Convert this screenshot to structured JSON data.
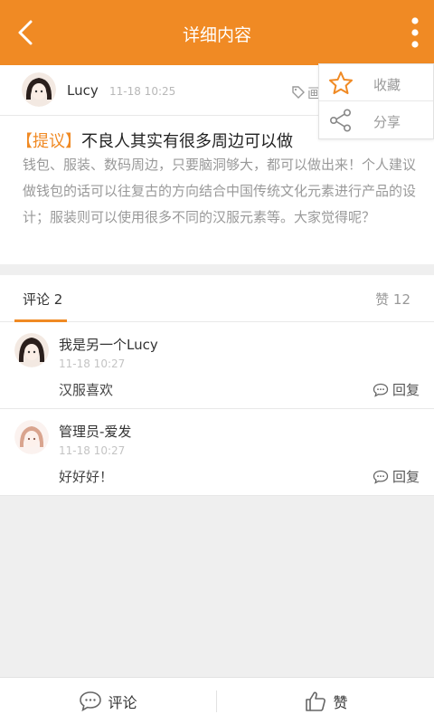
{
  "header": {
    "title": "详细内容",
    "back_icon": "back-arrow-icon",
    "more_icon": "more-vertical-icon",
    "bg_color": "#f08a24"
  },
  "author": {
    "name": "Lucy",
    "time": "11-18 10:25",
    "tag": "画",
    "tag_icon": "tag-icon"
  },
  "post": {
    "tag_label": "【提议】",
    "title": "不良人其实有很多周边可以做",
    "body": "钱包、服装、数码周边，只要脑洞够大，都可以做出来！个人建议做钱包的话可以往复古的方向结合中国传统文化元素进行产品的设计；服装则可以使用很多不同的汉服元素等。大家觉得呢？"
  },
  "tabs": {
    "comments_label": "评论 2",
    "likes_label": "赞 12"
  },
  "comments": [
    {
      "name": "我是另一个Lucy",
      "time": "11-18 10:27",
      "text": "汉服喜欢",
      "reply": "回复"
    },
    {
      "name": "管理员-爱发",
      "time": "11-18 10:27",
      "text": "好好好！",
      "reply": "回复"
    }
  ],
  "popup": {
    "items": [
      {
        "label": "收藏",
        "icon": "star-icon"
      },
      {
        "label": "分享",
        "icon": "share-icon"
      }
    ]
  },
  "bottom": {
    "comment_label": "评论",
    "like_label": "赞"
  }
}
